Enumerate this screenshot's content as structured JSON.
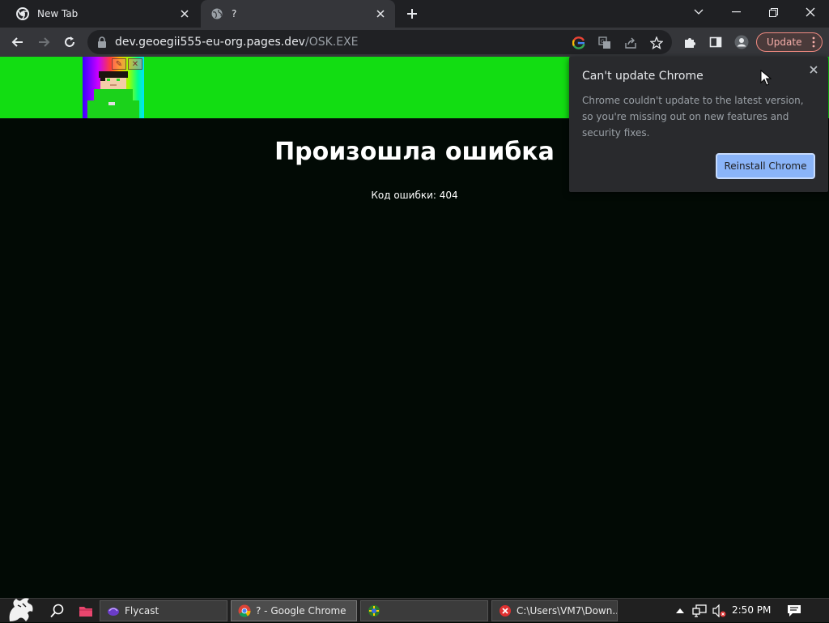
{
  "tabs": [
    {
      "title": "New Tab",
      "active": false
    },
    {
      "title": "?",
      "active": true
    }
  ],
  "toolbar": {
    "url_host": "dev.geoegii555-eu-org.pages.dev",
    "url_path": "/OSK.EXE",
    "update_label": "Update"
  },
  "page": {
    "heading": "Произошла ошибка",
    "error_code": "Код ошибки: 404"
  },
  "popup": {
    "title": "Can't update Chrome",
    "body": "Chrome couldn't update to the latest version, so you're missing out on new features and security fixes.",
    "button": "Reinstall Chrome"
  },
  "taskbar": {
    "tasks": [
      {
        "label": "Flycast"
      },
      {
        "label": "? - Google Chrome"
      },
      {
        "label": ""
      },
      {
        "label": "C:\\Users\\VM7\\Down..."
      }
    ],
    "clock": "2:50 PM"
  },
  "colors": {
    "banner": "#12dd12",
    "page_bg": "#020a05",
    "accent": "#8ab4f8",
    "update_border": "#f28b82"
  }
}
